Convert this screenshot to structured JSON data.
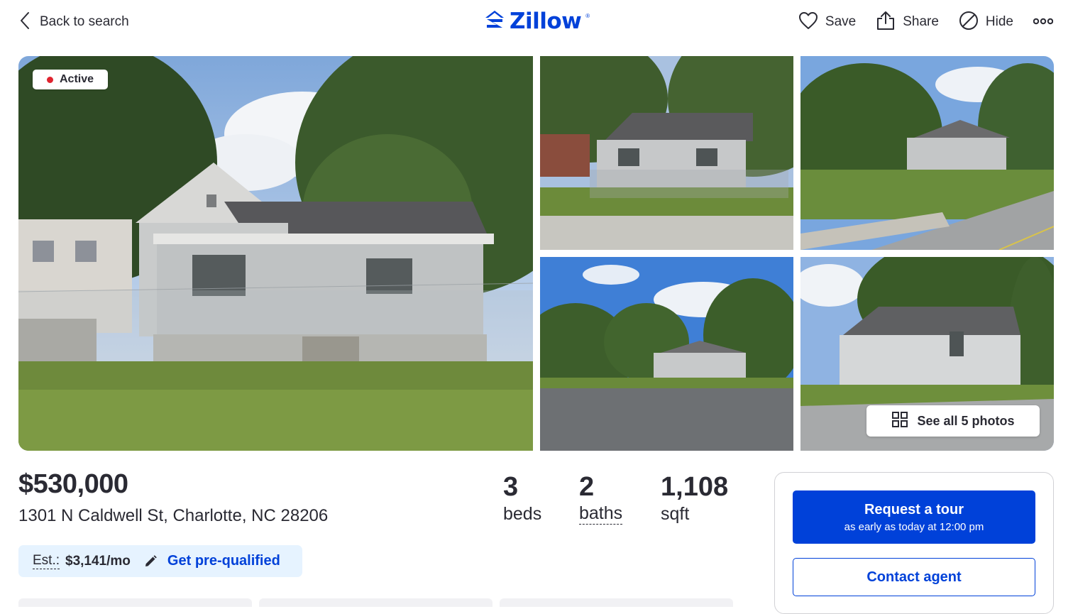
{
  "header": {
    "back_label": "Back to search",
    "logo_text": "Zillow",
    "logo_mark": "®",
    "actions": {
      "save_label": "Save",
      "share_label": "Share",
      "hide_label": "Hide"
    }
  },
  "gallery": {
    "status_badge": "Active",
    "see_all_label": "See all 5 photos"
  },
  "listing": {
    "price": "$530,000",
    "address": "1301 N Caldwell St, Charlotte, NC 28206",
    "beds_value": "3",
    "beds_label": "beds",
    "baths_value": "2",
    "baths_label": "baths",
    "sqft_value": "1,108",
    "sqft_label": "sqft"
  },
  "estimate": {
    "label": "Est.:",
    "value": "$3,141/mo",
    "link": "Get pre-qualified"
  },
  "cta": {
    "tour_title": "Request a tour",
    "tour_subtitle": "as early as today at 12:00 pm",
    "contact_label": "Contact agent"
  },
  "colors": {
    "brand_blue": "#0041d9",
    "active_red": "#e0242f",
    "estimate_bg": "#e6f3ff",
    "text": "#2a2a33"
  }
}
